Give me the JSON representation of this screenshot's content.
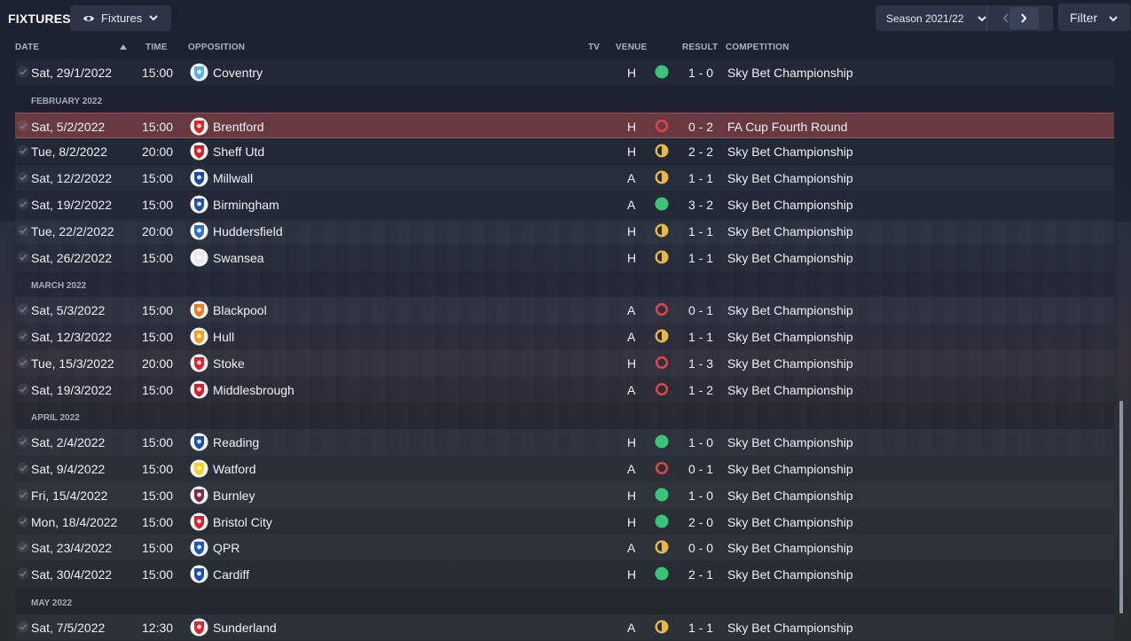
{
  "header": {
    "title": "FIXTURES",
    "view_label": "Fixtures",
    "season_label": "Season 2021/22",
    "filter_label": "Filter"
  },
  "columns": {
    "date": "DATE",
    "time": "TIME",
    "opposition": "OPPOSITION",
    "tv": "TV",
    "venue": "VENUE",
    "result": "RESULT",
    "competition": "COMPETITION"
  },
  "rows": [
    {
      "type": "match",
      "date": "Sat, 29/1/2022",
      "time": "15:00",
      "opponent": "Coventry",
      "crest": "#5ab0e8",
      "venue": "H",
      "outcome": "win",
      "result": "1 - 0",
      "competition": "Sky Bet Championship"
    },
    {
      "type": "month",
      "label": "FEBRUARY 2022"
    },
    {
      "type": "match",
      "date": "Sat, 5/2/2022",
      "time": "15:00",
      "opponent": "Brentford",
      "crest": "#d8262e",
      "venue": "H",
      "outcome": "loss",
      "result": "0 - 2",
      "competition": "FA Cup Fourth Round",
      "highlight": true
    },
    {
      "type": "match",
      "date": "Tue, 8/2/2022",
      "time": "20:00",
      "opponent": "Sheff Utd",
      "crest": "#d0202a",
      "venue": "H",
      "outcome": "draw",
      "result": "2 - 2",
      "competition": "Sky Bet Championship"
    },
    {
      "type": "match",
      "date": "Sat, 12/2/2022",
      "time": "15:00",
      "opponent": "Millwall",
      "crest": "#1f4aa8",
      "venue": "A",
      "outcome": "draw",
      "result": "1 - 1",
      "competition": "Sky Bet Championship"
    },
    {
      "type": "match",
      "date": "Sat, 19/2/2022",
      "time": "15:00",
      "opponent": "Birmingham",
      "crest": "#2a4ea3",
      "venue": "A",
      "outcome": "win",
      "result": "3 - 2",
      "competition": "Sky Bet Championship"
    },
    {
      "type": "match",
      "date": "Tue, 22/2/2022",
      "time": "20:00",
      "opponent": "Huddersfield",
      "crest": "#2f70c8",
      "venue": "H",
      "outcome": "draw",
      "result": "1 - 1",
      "competition": "Sky Bet Championship"
    },
    {
      "type": "match",
      "date": "Sat, 26/2/2022",
      "time": "15:00",
      "opponent": "Swansea",
      "crest": "#e8e8e8",
      "venue": "H",
      "outcome": "draw",
      "result": "1 - 1",
      "competition": "Sky Bet Championship"
    },
    {
      "type": "month",
      "label": "MARCH 2022"
    },
    {
      "type": "match",
      "date": "Sat, 5/3/2022",
      "time": "15:00",
      "opponent": "Blackpool",
      "crest": "#f07a20",
      "venue": "A",
      "outcome": "loss",
      "result": "0 - 1",
      "competition": "Sky Bet Championship"
    },
    {
      "type": "match",
      "date": "Sat, 12/3/2022",
      "time": "15:00",
      "opponent": "Hull",
      "crest": "#f2a11c",
      "venue": "A",
      "outcome": "draw",
      "result": "1 - 1",
      "competition": "Sky Bet Championship"
    },
    {
      "type": "match",
      "date": "Tue, 15/3/2022",
      "time": "20:00",
      "opponent": "Stoke",
      "crest": "#e0242f",
      "venue": "H",
      "outcome": "loss",
      "result": "1 - 3",
      "competition": "Sky Bet Championship"
    },
    {
      "type": "match",
      "date": "Sat, 19/3/2022",
      "time": "15:00",
      "opponent": "Middlesbrough",
      "crest": "#d51f2c",
      "venue": "A",
      "outcome": "loss",
      "result": "1 - 2",
      "competition": "Sky Bet Championship"
    },
    {
      "type": "month",
      "label": "APRIL 2022"
    },
    {
      "type": "match",
      "date": "Sat, 2/4/2022",
      "time": "15:00",
      "opponent": "Reading",
      "crest": "#1e4fa0",
      "venue": "H",
      "outcome": "win",
      "result": "1 - 0",
      "competition": "Sky Bet Championship"
    },
    {
      "type": "match",
      "date": "Sat, 9/4/2022",
      "time": "15:00",
      "opponent": "Watford",
      "crest": "#f3d220",
      "venue": "A",
      "outcome": "loss",
      "result": "0 - 1",
      "competition": "Sky Bet Championship"
    },
    {
      "type": "match",
      "date": "Fri, 15/4/2022",
      "time": "15:00",
      "opponent": "Burnley",
      "crest": "#7a2a44",
      "venue": "H",
      "outcome": "win",
      "result": "1 - 0",
      "competition": "Sky Bet Championship"
    },
    {
      "type": "match",
      "date": "Mon, 18/4/2022",
      "time": "15:00",
      "opponent": "Bristol City",
      "crest": "#d5232f",
      "venue": "H",
      "outcome": "win",
      "result": "2 - 0",
      "competition": "Sky Bet Championship"
    },
    {
      "type": "match",
      "date": "Sat, 23/4/2022",
      "time": "15:00",
      "opponent": "QPR",
      "crest": "#1d5ab5",
      "venue": "A",
      "outcome": "draw",
      "result": "0 - 0",
      "competition": "Sky Bet Championship"
    },
    {
      "type": "match",
      "date": "Sat, 30/4/2022",
      "time": "15:00",
      "opponent": "Cardiff",
      "crest": "#1c4fa5",
      "venue": "H",
      "outcome": "win",
      "result": "2 - 1",
      "competition": "Sky Bet Championship"
    },
    {
      "type": "month",
      "label": "MAY 2022"
    },
    {
      "type": "match",
      "date": "Sat, 7/5/2022",
      "time": "12:30",
      "opponent": "Sunderland",
      "crest": "#d42a30",
      "venue": "A",
      "outcome": "draw",
      "result": "1 - 1",
      "competition": "Sky Bet Championship"
    }
  ],
  "colors": {
    "win": "#3cc27a",
    "draw": "#e8b64a",
    "loss": "#d9444c"
  }
}
